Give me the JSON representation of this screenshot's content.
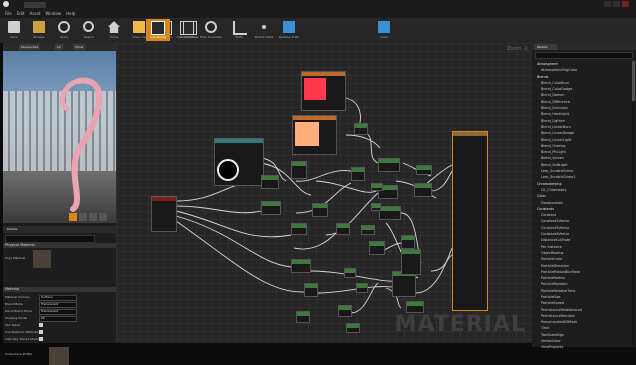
{
  "app": {
    "title": "Unreal Editor"
  },
  "menu": [
    "File",
    "Edit",
    "Asset",
    "Window",
    "Help"
  ],
  "toolbar": {
    "buttons": [
      {
        "label": "Save",
        "icon": "save-icon"
      },
      {
        "label": "Browse",
        "icon": "browse-icon"
      },
      {
        "label": "Apply",
        "icon": "apply-icon"
      },
      {
        "label": "Search",
        "icon": "search-icon"
      },
      {
        "label": "Home",
        "icon": "home-icon"
      },
      {
        "label": "Clean Up",
        "icon": "cleanup-icon"
      },
      {
        "label": "Connectors",
        "icon": "connectors-icon"
      },
      {
        "label": "Live Preview",
        "icon": "live-preview-icon"
      },
      {
        "label": "Live Nodes",
        "icon": "live-nodes-icon"
      },
      {
        "label": "Live Update",
        "icon": "live-update-icon"
      },
      {
        "label": "Hide Unrelated",
        "icon": "hide-unrelated-icon"
      },
      {
        "label": "Stats",
        "icon": "stats-icon"
      },
      {
        "label": "Mobile Stats",
        "icon": "mobile-stats-icon"
      },
      {
        "label": "Release Stats",
        "icon": "release-stats-icon"
      },
      {
        "label": "Level",
        "icon": "level-icon"
      }
    ],
    "active_index": 8
  },
  "viewport": {
    "tab_label": "Perspective",
    "tab2": "Lit",
    "tab3": "Show"
  },
  "details": {
    "tab_label": "Details",
    "sections": [
      {
        "title": "Physical Material"
      },
      {
        "title": "Material"
      }
    ],
    "rows": [
      {
        "label": "Phys Material",
        "value": "None"
      },
      {
        "label": "Material Domain",
        "value": "Surface"
      },
      {
        "label": "Blend Mode",
        "value": "Translucent"
      },
      {
        "label": "Decal Blend Mode",
        "value": "Translucent"
      },
      {
        "label": "Shading Model",
        "value": "Lit"
      },
      {
        "label": "Two Sided",
        "value": ""
      },
      {
        "label": "Use Material Attributes",
        "value": ""
      },
      {
        "label": "Cast Ray Traced Shadows",
        "value": ""
      },
      {
        "label": "Subsurface Profile",
        "value": "None"
      }
    ]
  },
  "graph": {
    "zoom_label": "Zoom -1",
    "watermark": "MATERIAL"
  },
  "palette": {
    "tab_label": "Palette",
    "items": [
      {
        "type": "cat",
        "text": "Atmosphere"
      },
      {
        "type": "itm",
        "text": "AtmosphericFogColor"
      },
      {
        "type": "cat",
        "text": "Blends"
      },
      {
        "type": "itm",
        "text": "Blend_ColorBurn"
      },
      {
        "type": "itm",
        "text": "Blend_ColorDodge"
      },
      {
        "type": "itm",
        "text": "Blend_Darken"
      },
      {
        "type": "itm",
        "text": "Blend_Difference"
      },
      {
        "type": "itm",
        "text": "Blend_Exclusion"
      },
      {
        "type": "itm",
        "text": "Blend_HardLight"
      },
      {
        "type": "itm",
        "text": "Blend_Lighten"
      },
      {
        "type": "itm",
        "text": "Blend_LinearBurn"
      },
      {
        "type": "itm",
        "text": "Blend_LinearDodge"
      },
      {
        "type": "itm",
        "text": "Blend_LinearLight"
      },
      {
        "type": "itm",
        "text": "Blend_Overlay"
      },
      {
        "type": "itm",
        "text": "Blend_PinLight"
      },
      {
        "type": "itm",
        "text": "Blend_Screen"
      },
      {
        "type": "itm",
        "text": "Blend_SoftLight"
      },
      {
        "type": "itm",
        "text": "Lerp_ScratchGrime"
      },
      {
        "type": "itm",
        "text": "Lerp_ScratchGrime2"
      },
      {
        "type": "cat",
        "text": "Chromakeying"
      },
      {
        "type": "itm",
        "text": "CK_Chromakey"
      },
      {
        "type": "cat",
        "text": "Color"
      },
      {
        "type": "itm",
        "text": "Desaturation"
      },
      {
        "type": "cat",
        "text": "Constants"
      },
      {
        "type": "itm",
        "text": "Constant"
      },
      {
        "type": "itm",
        "text": "Constant2Vector"
      },
      {
        "type": "itm",
        "text": "Constant3Vector"
      },
      {
        "type": "itm",
        "text": "Constant4Vector"
      },
      {
        "type": "itm",
        "text": "DistanceCullFade"
      },
      {
        "type": "itm",
        "text": "Per Instance"
      },
      {
        "type": "itm",
        "text": "ObjectRadius"
      },
      {
        "type": "itm",
        "text": "ParticleColor"
      },
      {
        "type": "itm",
        "text": "ParticleDirection"
      },
      {
        "type": "itm",
        "text": "ParticleMotionBlurFade"
      },
      {
        "type": "itm",
        "text": "ParticleRadius"
      },
      {
        "type": "itm",
        "text": "ParticleRandom"
      },
      {
        "type": "itm",
        "text": "ParticleRelativeTime"
      },
      {
        "type": "itm",
        "text": "ParticleSize"
      },
      {
        "type": "itm",
        "text": "ParticleSpeed"
      },
      {
        "type": "itm",
        "text": "PerInstanceFadeAmount"
      },
      {
        "type": "itm",
        "text": "PerInstanceRandom"
      },
      {
        "type": "itm",
        "text": "PrecomputedAOMask"
      },
      {
        "type": "itm",
        "text": "Time"
      },
      {
        "type": "itm",
        "text": "TwoSidedSign"
      },
      {
        "type": "itm",
        "text": "VertexColor"
      },
      {
        "type": "itm",
        "text": "ViewProperty"
      }
    ]
  },
  "nodes": {
    "color_red": "#ff3a4f",
    "color_peach": "#ffad7c",
    "accent": "#d7861b"
  }
}
